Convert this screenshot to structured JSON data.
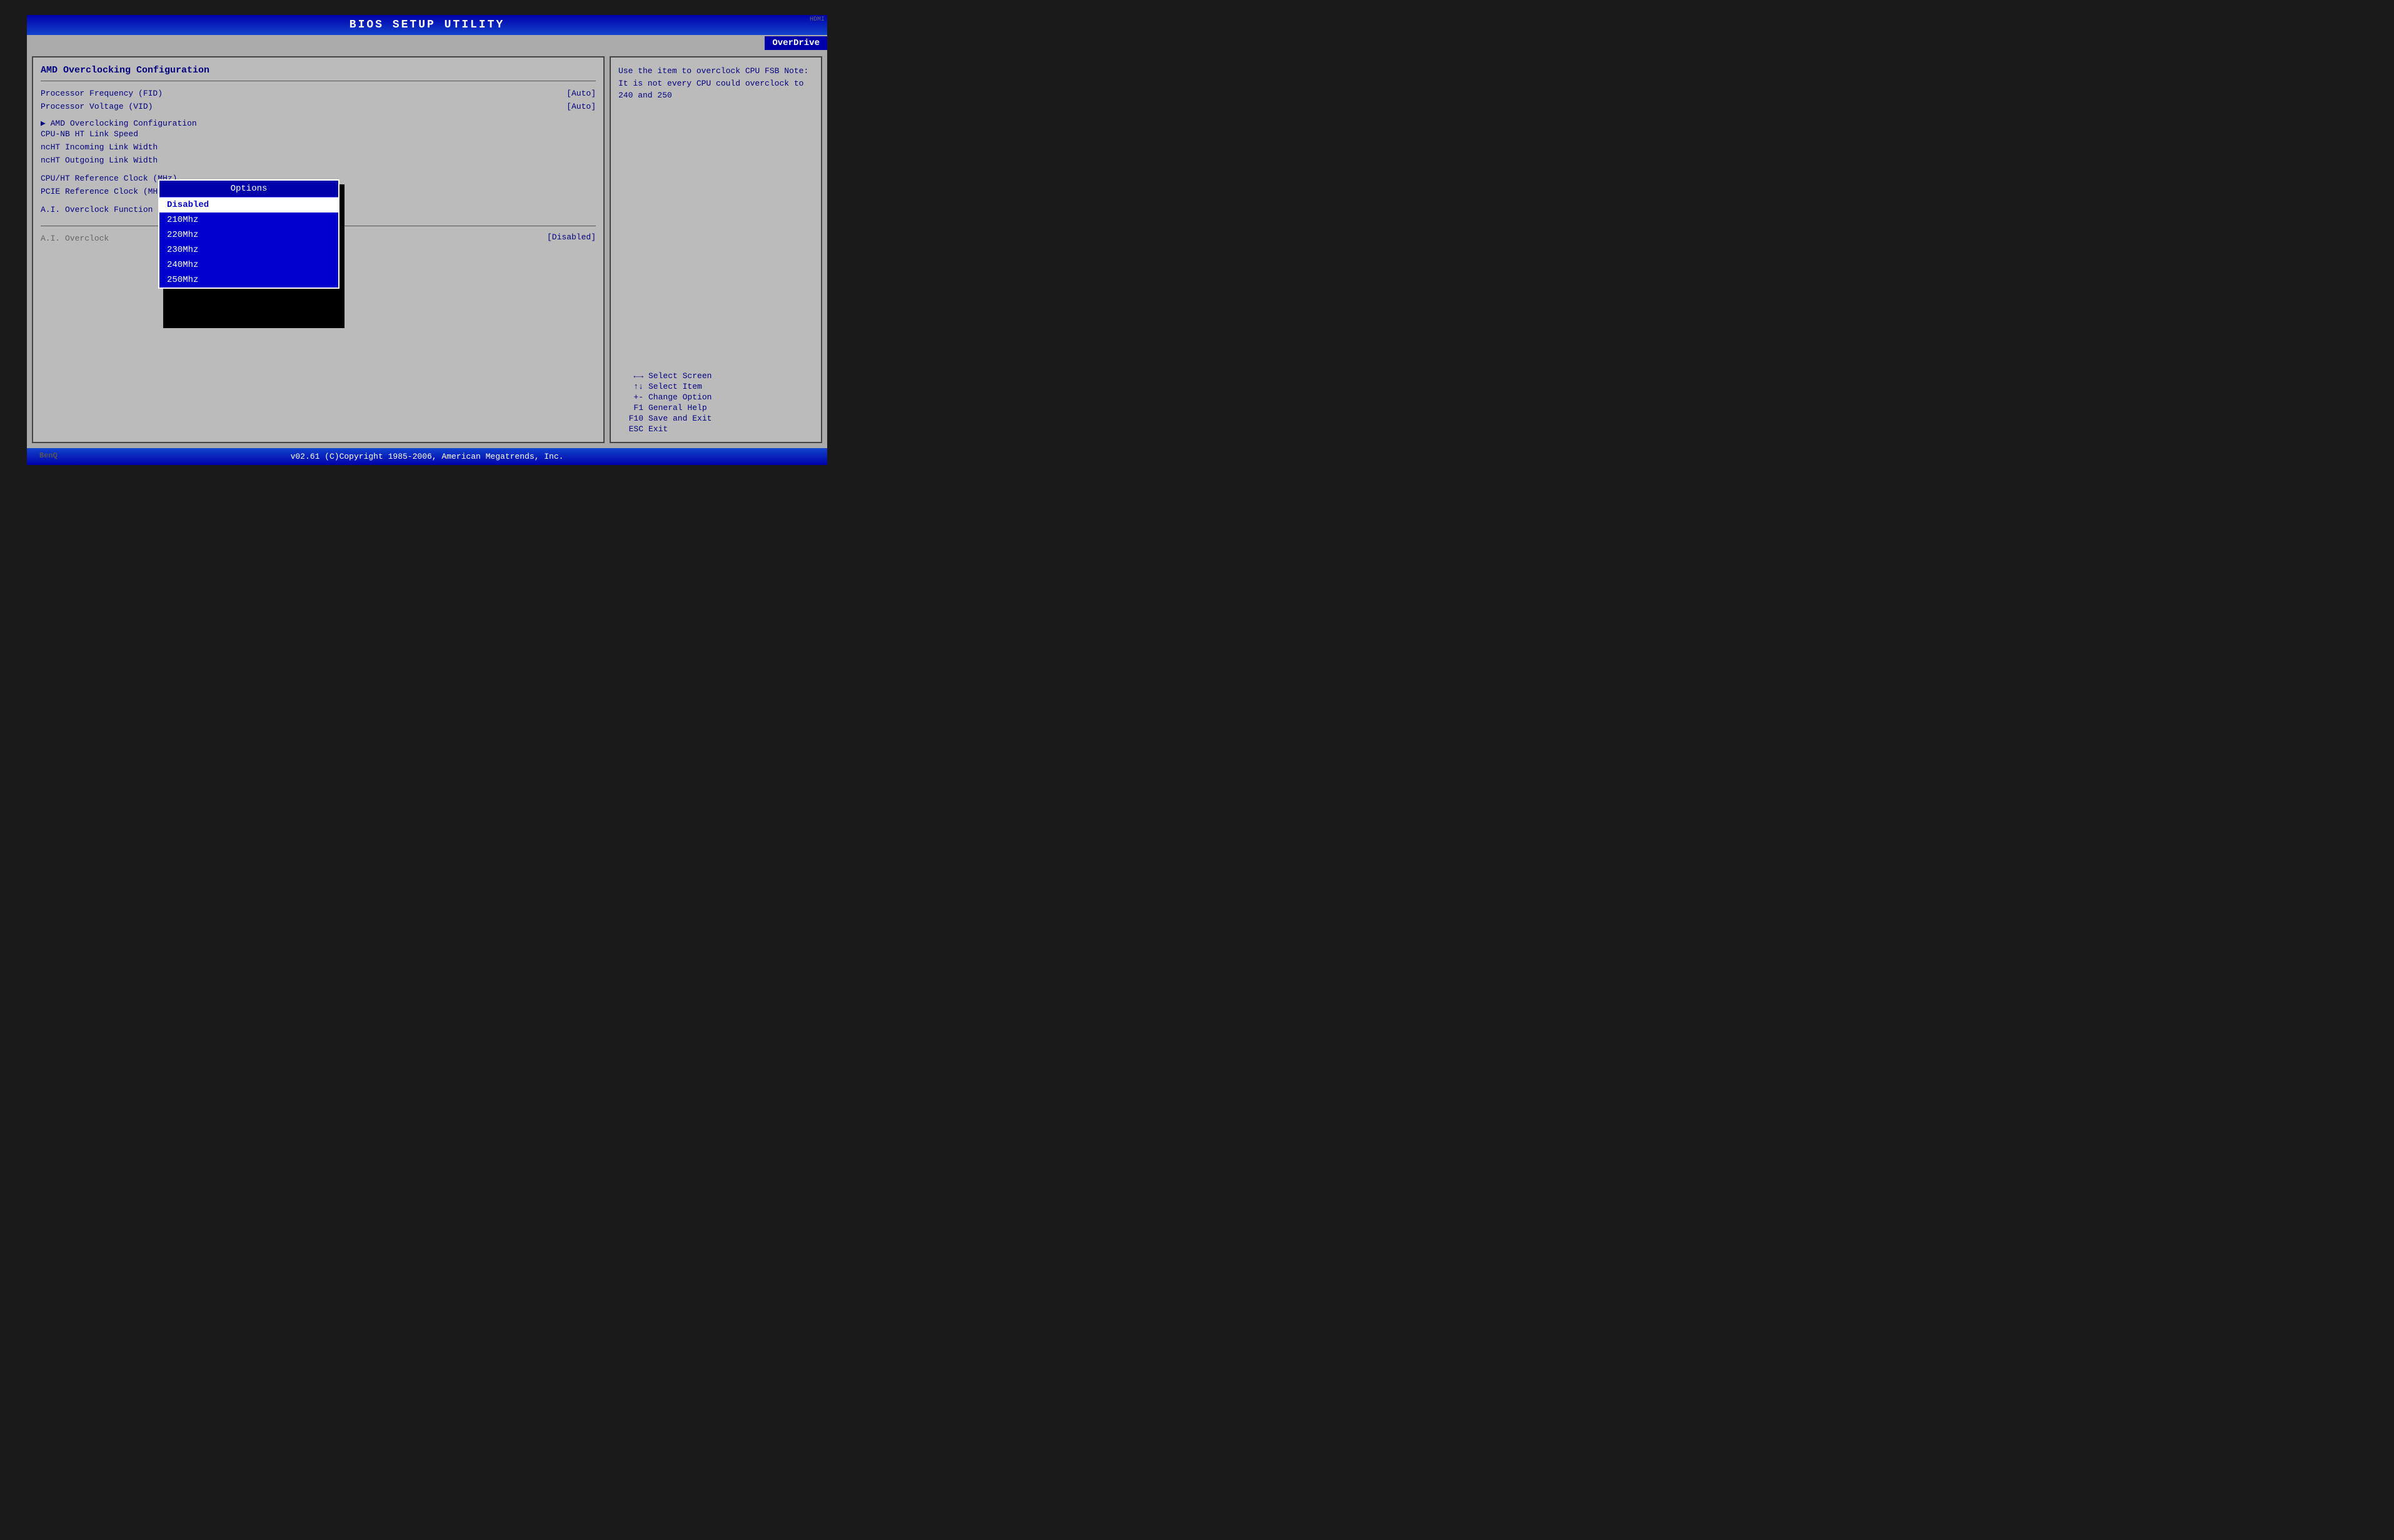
{
  "header": {
    "title": "BIOS  SETUP  UTILITY"
  },
  "tabs": {
    "active": "OverDrive",
    "items": [
      "OverDrive"
    ]
  },
  "left_panel": {
    "section_title": "AMD Overclocking Configuration",
    "menu_items": [
      {
        "label": "Processor Frequency (FID)",
        "value": "[Auto]"
      },
      {
        "label": "Processor Voltage (VID)",
        "value": "[Auto]"
      }
    ],
    "submenu_items": [
      {
        "type": "arrow",
        "label": "▶  AMD Overclocking Configuration"
      },
      {
        "type": "plain",
        "label": "CPU-NB HT Link Speed"
      },
      {
        "type": "plain",
        "label": "ncHT Incoming Link Width"
      },
      {
        "type": "plain",
        "label": "ncHT Outgoing Link Width"
      }
    ],
    "ref_items": [
      {
        "label": "CPU/HT Reference Clock (MHz)"
      },
      {
        "label": "PCIE Reference Clock (MHz)"
      }
    ],
    "overclock_function": "A.I. Overclock Function",
    "bottom": {
      "label": "A.I. Overclock",
      "value": "[Disabled]"
    }
  },
  "dropdown": {
    "title": "Options",
    "items": [
      {
        "label": "Disabled",
        "selected": true
      },
      {
        "label": "210Mhz",
        "selected": false
      },
      {
        "label": "220Mhz",
        "selected": false
      },
      {
        "label": "230Mhz",
        "selected": false
      },
      {
        "label": "240Mhz",
        "selected": false
      },
      {
        "label": "250Mhz",
        "selected": false
      }
    ]
  },
  "right_panel": {
    "help_text": "Use the item to overclock CPU FSB Note: It is not every CPU could overclock to 240 and 250",
    "keybindings": [
      {
        "key": "←→",
        "desc": "Select Screen"
      },
      {
        "key": "↑↓",
        "desc": "Select Item"
      },
      {
        "key": "+-",
        "desc": "Change Option"
      },
      {
        "key": "F1",
        "desc": "General Help"
      },
      {
        "key": "F10",
        "desc": "Save and Exit"
      },
      {
        "key": "ESC",
        "desc": "Exit"
      }
    ]
  },
  "footer": {
    "text": "v02.61 (C)Copyright 1985-2006, American Megatrends, Inc."
  },
  "branding": {
    "monitor": "BenQ",
    "hdmi": "HDMI"
  }
}
